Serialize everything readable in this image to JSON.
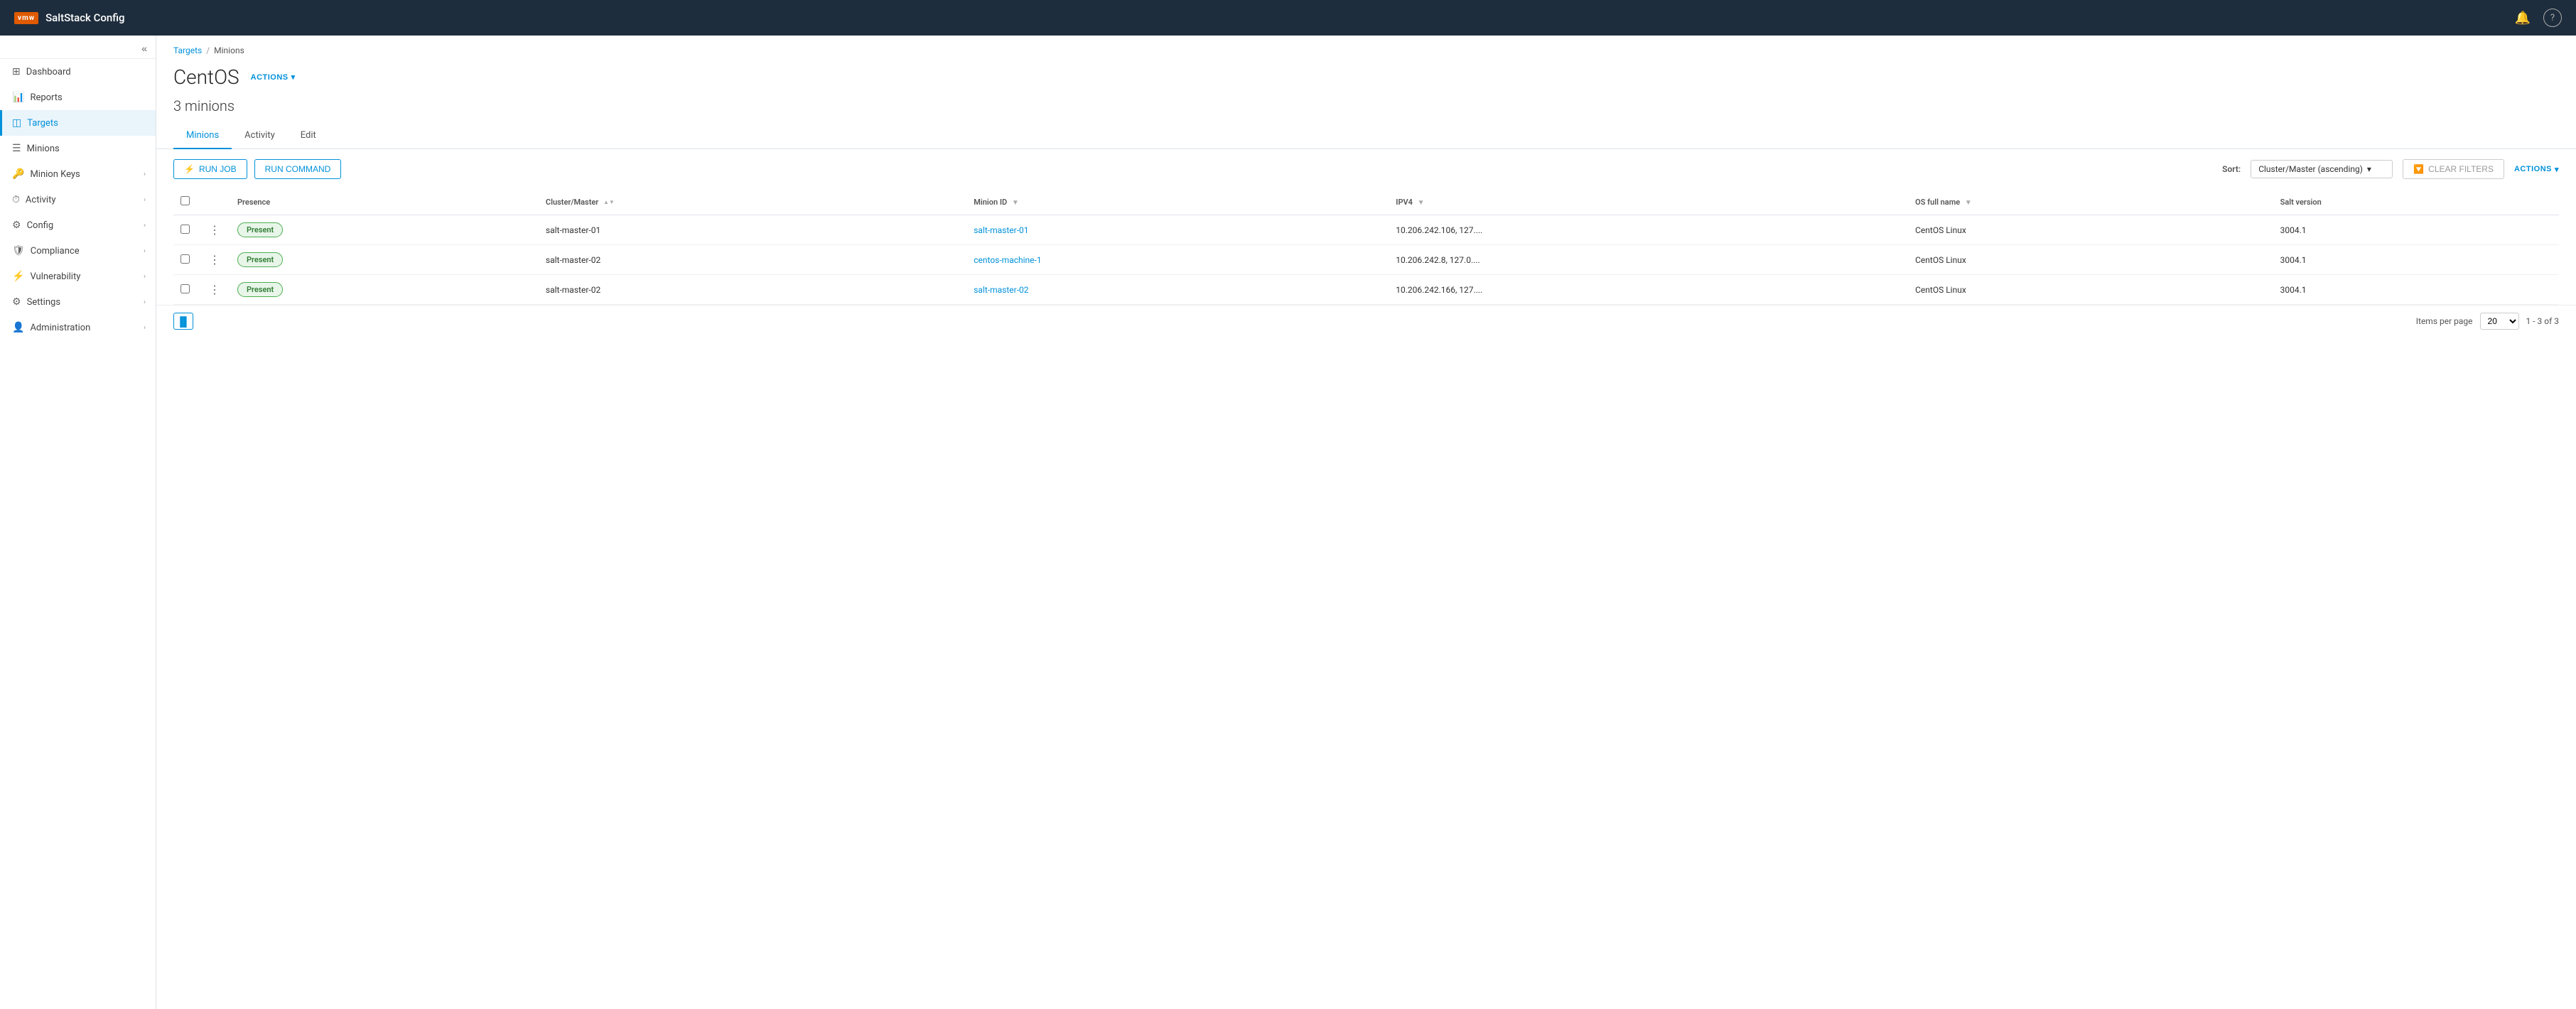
{
  "topnav": {
    "logo": "vmw",
    "title": "SaltStack Config",
    "bell_icon": "🔔",
    "help_icon": "?"
  },
  "sidebar": {
    "collapse_icon": "«",
    "items": [
      {
        "id": "dashboard",
        "label": "Dashboard",
        "icon": "⊞",
        "active": false,
        "has_children": false
      },
      {
        "id": "reports",
        "label": "Reports",
        "icon": "📊",
        "active": false,
        "has_children": false
      },
      {
        "id": "targets",
        "label": "Targets",
        "icon": "◫",
        "active": true,
        "has_children": false
      },
      {
        "id": "minions",
        "label": "Minions",
        "icon": "☰",
        "active": false,
        "has_children": false
      },
      {
        "id": "minion-keys",
        "label": "Minion Keys",
        "icon": "🔑",
        "active": false,
        "has_children": true
      },
      {
        "id": "activity",
        "label": "Activity",
        "icon": "⏱",
        "active": false,
        "has_children": true
      },
      {
        "id": "config",
        "label": "Config",
        "icon": "⚙",
        "active": false,
        "has_children": true
      },
      {
        "id": "compliance",
        "label": "Compliance",
        "icon": "🛡",
        "active": false,
        "has_children": true
      },
      {
        "id": "vulnerability",
        "label": "Vulnerability",
        "icon": "⚡",
        "active": false,
        "has_children": true
      },
      {
        "id": "settings",
        "label": "Settings",
        "icon": "⚙",
        "active": false,
        "has_children": true
      },
      {
        "id": "administration",
        "label": "Administration",
        "icon": "👤",
        "active": false,
        "has_children": true
      }
    ]
  },
  "breadcrumb": {
    "parent_label": "Targets",
    "separator": "/",
    "current": "Minions"
  },
  "page": {
    "title": "CentOS",
    "actions_label": "ACTIONS",
    "actions_chevron": "▾",
    "minions_count": "3 minions"
  },
  "tabs": [
    {
      "id": "minions",
      "label": "Minions",
      "active": true
    },
    {
      "id": "activity",
      "label": "Activity",
      "active": false
    },
    {
      "id": "edit",
      "label": "Edit",
      "active": false
    }
  ],
  "toolbar": {
    "run_job_label": "RUN JOB",
    "run_job_icon": "⚡",
    "run_command_label": "RUN COMMAND",
    "sort_label": "Sort:",
    "sort_value": "Cluster/Master (ascending)",
    "sort_chevron": "▾",
    "clear_filters_label": "CLEAR FILTERS",
    "clear_filters_icon": "🔽",
    "actions_label": "ACTIONS",
    "actions_chevron": "▾"
  },
  "table": {
    "columns": [
      {
        "id": "presence",
        "label": "Presence",
        "sortable": false,
        "filterable": false
      },
      {
        "id": "cluster-master",
        "label": "Cluster/Master",
        "sortable": true,
        "filterable": false
      },
      {
        "id": "minion-id",
        "label": "Minion ID",
        "sortable": false,
        "filterable": true
      },
      {
        "id": "ipv4",
        "label": "IPV4",
        "sortable": false,
        "filterable": true
      },
      {
        "id": "os-full-name",
        "label": "OS full name",
        "sortable": false,
        "filterable": true
      },
      {
        "id": "salt-version",
        "label": "Salt version",
        "sortable": false,
        "filterable": false
      }
    ],
    "rows": [
      {
        "presence": "Present",
        "cluster_master": "salt-master-01",
        "minion_id": "salt-master-01",
        "minion_id_is_link": true,
        "ipv4": "10.206.242.106, 127....",
        "os_full_name": "CentOS Linux",
        "salt_version": "3004.1"
      },
      {
        "presence": "Present",
        "cluster_master": "salt-master-02",
        "minion_id": "centos-machine-1",
        "minion_id_is_link": true,
        "ipv4": "10.206.242.8, 127.0....",
        "os_full_name": "CentOS Linux",
        "salt_version": "3004.1"
      },
      {
        "presence": "Present",
        "cluster_master": "salt-master-02",
        "minion_id": "salt-master-02",
        "minion_id_is_link": true,
        "ipv4": "10.206.242.166, 127....",
        "os_full_name": "CentOS Linux",
        "salt_version": "3004.1"
      }
    ]
  },
  "footer": {
    "col_toggle_icon": "▐▌",
    "items_per_page_label": "Items per page",
    "items_per_page_value": "20",
    "page_info": "1 - 3 of 3"
  }
}
